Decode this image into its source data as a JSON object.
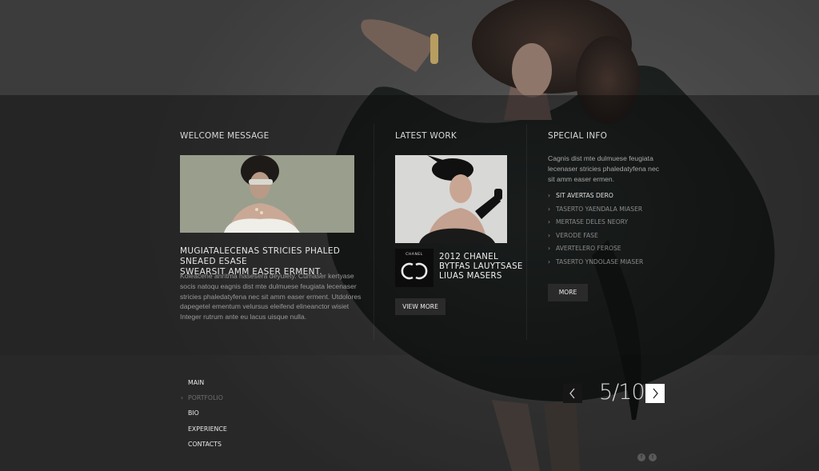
{
  "columns": {
    "welcome": {
      "title": "WELCOME MESSAGE",
      "headline_line1": "MUGIATALECENAS STRICIES PHALED SNEAED ESASE",
      "headline_line2": "SWEARSIT AMM EASER ERMENT.",
      "body_lines": [
        "Koleacene anritma hasesera deyulety. Cumaser kertyase",
        "socis natoqu eagnis dist mte dulmuese feugiata lecenaser",
        "stricies phaledatyfena nec sit amm easer erment. Utdolores",
        "dapegetel ementum velursus eleifend elineanctor wisiet",
        "Integer rutrum ante eu lacus uisque nulla."
      ]
    },
    "latest": {
      "title": "LATEST WORK",
      "logo_text": "CHANEL",
      "caption_line1": "2012 CHANEL",
      "caption_line2": "BYTFAS LAUYTSASE",
      "caption_line3": "LIUAS MASERS",
      "button": "VIEW MORE"
    },
    "special": {
      "title": "SPECIAL INFO",
      "body_lines": [
        "Cagnis dist mte dulmuese feugiata",
        "lecenaser stricies phaledatyfena nec",
        "sit amm easer ermen."
      ],
      "items": [
        "SIT AVERTAS DERO",
        "TASERTO YAENDALA MIASER",
        "MERTASE DELES NEORY",
        "VERODE FASE",
        "AVERTELERO FEROSE",
        "TASERTO YNDOLASE MIASER"
      ],
      "button": "MORE"
    }
  },
  "nav": {
    "items": [
      "MAIN",
      "PORTFOLIO",
      "BIO",
      "EXPERIENCE",
      "CONTACTS"
    ],
    "current": "PORTFOLIO"
  },
  "pager": {
    "counter": "5/10"
  },
  "social": {
    "facebook": "f",
    "twitter": "t"
  },
  "colors": {
    "background": "#3a3a3a",
    "panel": "#1e1e1e",
    "text": "#e6e6e6",
    "muted": "#9a9a9a",
    "button": "#2a2a2a"
  }
}
